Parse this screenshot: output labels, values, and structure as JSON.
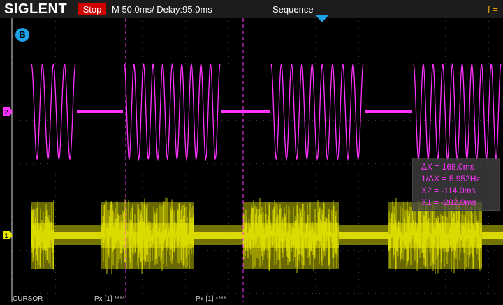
{
  "header": {
    "logo": "SIGLENT",
    "status": "Stop",
    "timebase": "M 50.0ms/ Delay:95.0ms",
    "mode": "Sequence",
    "freq": "f ="
  },
  "markers": {
    "badge_b": "B",
    "ch2": "2",
    "ch1": "1"
  },
  "measurements": {
    "delta_x": "ΔX = 168.0ms",
    "inv_delta_x": "1/ΔX = 5.952Hz",
    "x2": "X2 = -114.0ms",
    "x1": "X1 = -282.0ms"
  },
  "footer": {
    "menu": "CURSOR",
    "item1": "Px [1] ****",
    "item2": "Px [1] ****"
  },
  "colors": {
    "ch1": "#e6e600",
    "ch2": "#ff33ff",
    "cursor": "#ff33ff",
    "trigger": "#1ea0e6",
    "stop": "#d10000"
  }
}
